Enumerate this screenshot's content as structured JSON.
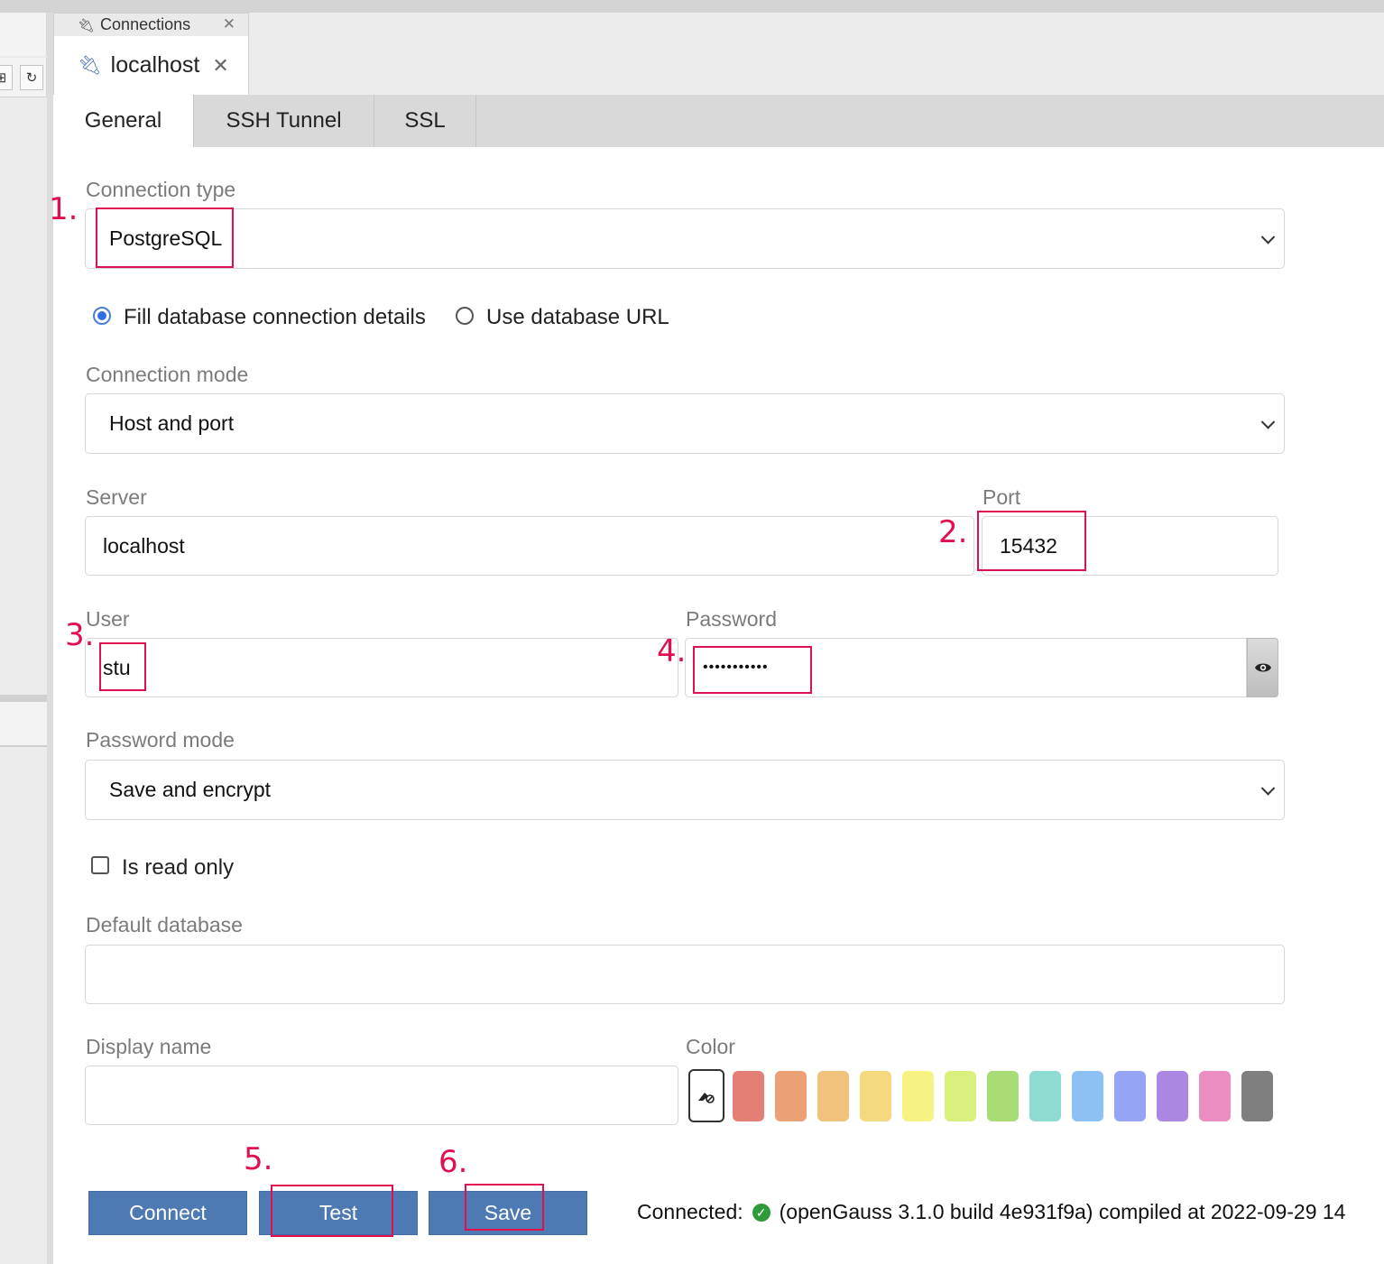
{
  "tabs": {
    "connections_tab": "Connections",
    "localhost_tab": "localhost"
  },
  "subtabs": [
    "General",
    "SSH Tunnel",
    "SSL"
  ],
  "form": {
    "connection_type_label": "Connection type",
    "connection_type_value": "PostgreSQL",
    "radio_fill_details": "Fill database connection details",
    "radio_use_url": "Use database URL",
    "connection_mode_label": "Connection mode",
    "connection_mode_value": "Host and port",
    "server_label": "Server",
    "server_value": "localhost",
    "port_label": "Port",
    "port_value": "15432",
    "user_label": "User",
    "user_value": "stu",
    "password_label": "Password",
    "password_value": "•••••••••••",
    "password_mode_label": "Password mode",
    "password_mode_value": "Save and encrypt",
    "read_only_label": "Is read only",
    "default_database_label": "Default database",
    "default_database_value": "",
    "display_name_label": "Display name",
    "display_name_value": "",
    "color_label": "Color"
  },
  "colors": [
    "#e37f74",
    "#eba075",
    "#f0c27c",
    "#f4d97e",
    "#f7f382",
    "#d9ef7e",
    "#a8dd76",
    "#8ddbd1",
    "#8dc1f5",
    "#95a4f4",
    "#ac87e2",
    "#eb8dc1",
    "#7f7f7f"
  ],
  "buttons": {
    "connect": "Connect",
    "test": "Test",
    "save": "Save"
  },
  "status": {
    "prefix": "Connected:",
    "text": "(openGauss 3.1.0 build 4e931f9a) compiled at 2022-09-29 14"
  },
  "annotations": [
    "1.",
    "2.",
    "3.",
    "4.",
    "5.",
    "6."
  ]
}
